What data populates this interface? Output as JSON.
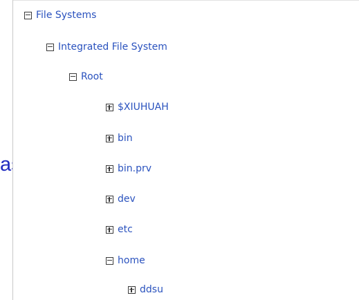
{
  "backdrop": {
    "text": "asily"
  },
  "tree": {
    "nodes": [
      {
        "label": "File Systems",
        "state": "collapse"
      },
      {
        "label": "Integrated File System",
        "state": "collapse"
      },
      {
        "label": "Root",
        "state": "collapse"
      },
      {
        "label": "$XIUHUAH",
        "state": "expand"
      },
      {
        "label": "bin",
        "state": "expand"
      },
      {
        "label": "bin.prv",
        "state": "expand"
      },
      {
        "label": "dev",
        "state": "expand"
      },
      {
        "label": "etc",
        "state": "expand"
      },
      {
        "label": "home",
        "state": "collapse"
      },
      {
        "label": "ddsu",
        "state": "expand"
      }
    ]
  },
  "colors": {
    "link": "#2a52be",
    "backdrop_text": "#1f2bbf",
    "toggle_border": "#3a3a3a"
  }
}
